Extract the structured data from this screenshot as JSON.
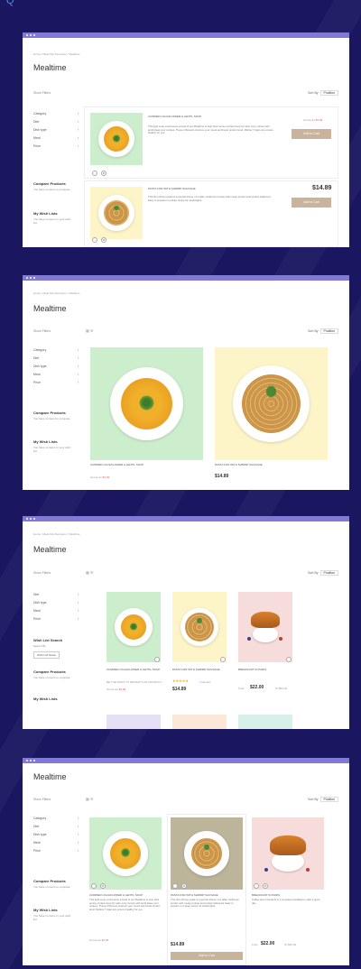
{
  "top_link": "Q",
  "colors": {
    "background": "#1b1660",
    "window_bar": "#8079d6",
    "button": "#c9b39a",
    "old_price": "#e2574c"
  },
  "breadcrumb": "Home / Meal Kits Decorator / Mealtime",
  "page_title": "Mealtime",
  "show_filters": "Show Filters",
  "sort_label": "Sort By",
  "sort_value": "Position",
  "filters": [
    "Category",
    "Diet",
    "Dish type",
    "Meal",
    "Price"
  ],
  "compare": {
    "title": "Compare Products",
    "text": "You have no items to compare."
  },
  "wishlist": {
    "title": "My Wish Lists",
    "text": "You have no items in your wish list."
  },
  "wishlist_search": {
    "title": "Wish List Search",
    "label": "Search By",
    "select": "Wish List Name"
  },
  "products": [
    {
      "name": "CURRIED CAULIFLOWER & LENTIL SOUP",
      "old_price": "As low as",
      "price": "$7.29",
      "desc": "This light soup could serve a bowl of our Mealtime to stop their sense of plant soup for calm cozy curries with lentil ideas your recipes. These 4 flavours improve your mood and boost protein level. Mellow 7 Apps are ensure healthy for you."
    },
    {
      "name": "PASTA FOR WITH SHRIMP SAUSAGE",
      "price": "$14.89",
      "desc": "This first shrimp pasta is a special dinner of a table. Delicious tomato with meaty protein and protein balanced. Easy to prepare in a deep recipe for weeknights."
    },
    {
      "name": "BREAKFAST IN PARIS",
      "price": "$22.00",
      "old_price": "To $56.00",
      "desc": "Coffee and croissants in a complete breakfast to start a good day."
    }
  ],
  "add_to_cart": "Add to Cart",
  "be_first_review": "BE THE FIRST TO REVIEW THIS PRODUCT",
  "review_count": "1 Review",
  "price_from": "From",
  "price_2": "$14.89",
  "price_3": "$22.00"
}
